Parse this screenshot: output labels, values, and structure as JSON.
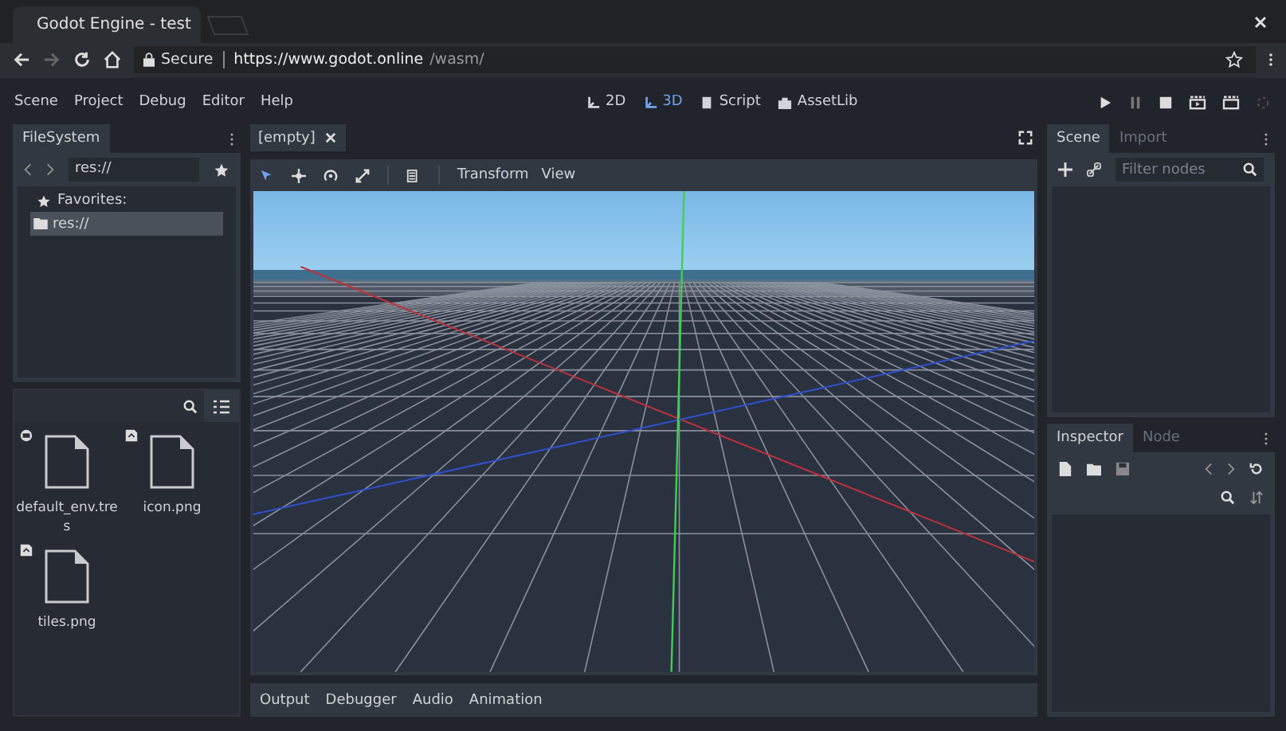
{
  "browser": {
    "tab_title": "Godot Engine - test",
    "security": "Secure",
    "url_main": "https://www.godot.online",
    "url_path": "/wasm/"
  },
  "menu": [
    "Scene",
    "Project",
    "Debug",
    "Editor",
    "Help"
  ],
  "workspaces": [
    {
      "label": "2D",
      "selected": false
    },
    {
      "label": "3D",
      "selected": true
    },
    {
      "label": "Script",
      "selected": false
    },
    {
      "label": "AssetLib",
      "selected": false
    }
  ],
  "filesystem": {
    "tab": "FileSystem",
    "path": "res://",
    "favorites": "Favorites:",
    "tree": [
      {
        "label": "res://",
        "selected": true
      }
    ],
    "files": [
      {
        "name": "default_env.tres",
        "kind": "resource"
      },
      {
        "name": "icon.png",
        "kind": "image"
      },
      {
        "name": "tiles.png",
        "kind": "image"
      }
    ]
  },
  "editor": {
    "tabs": [
      "[empty]"
    ],
    "toolbar": [
      "Transform",
      "View"
    ]
  },
  "scene_dock": {
    "tabs": [
      {
        "label": "Scene",
        "selected": true
      },
      {
        "label": "Import",
        "selected": false
      }
    ],
    "filter_placeholder": "Filter nodes"
  },
  "inspector_dock": {
    "tabs": [
      {
        "label": "Inspector",
        "selected": true
      },
      {
        "label": "Node",
        "selected": false
      }
    ]
  },
  "bottom_tabs": [
    "Output",
    "Debugger",
    "Audio",
    "Animation"
  ]
}
